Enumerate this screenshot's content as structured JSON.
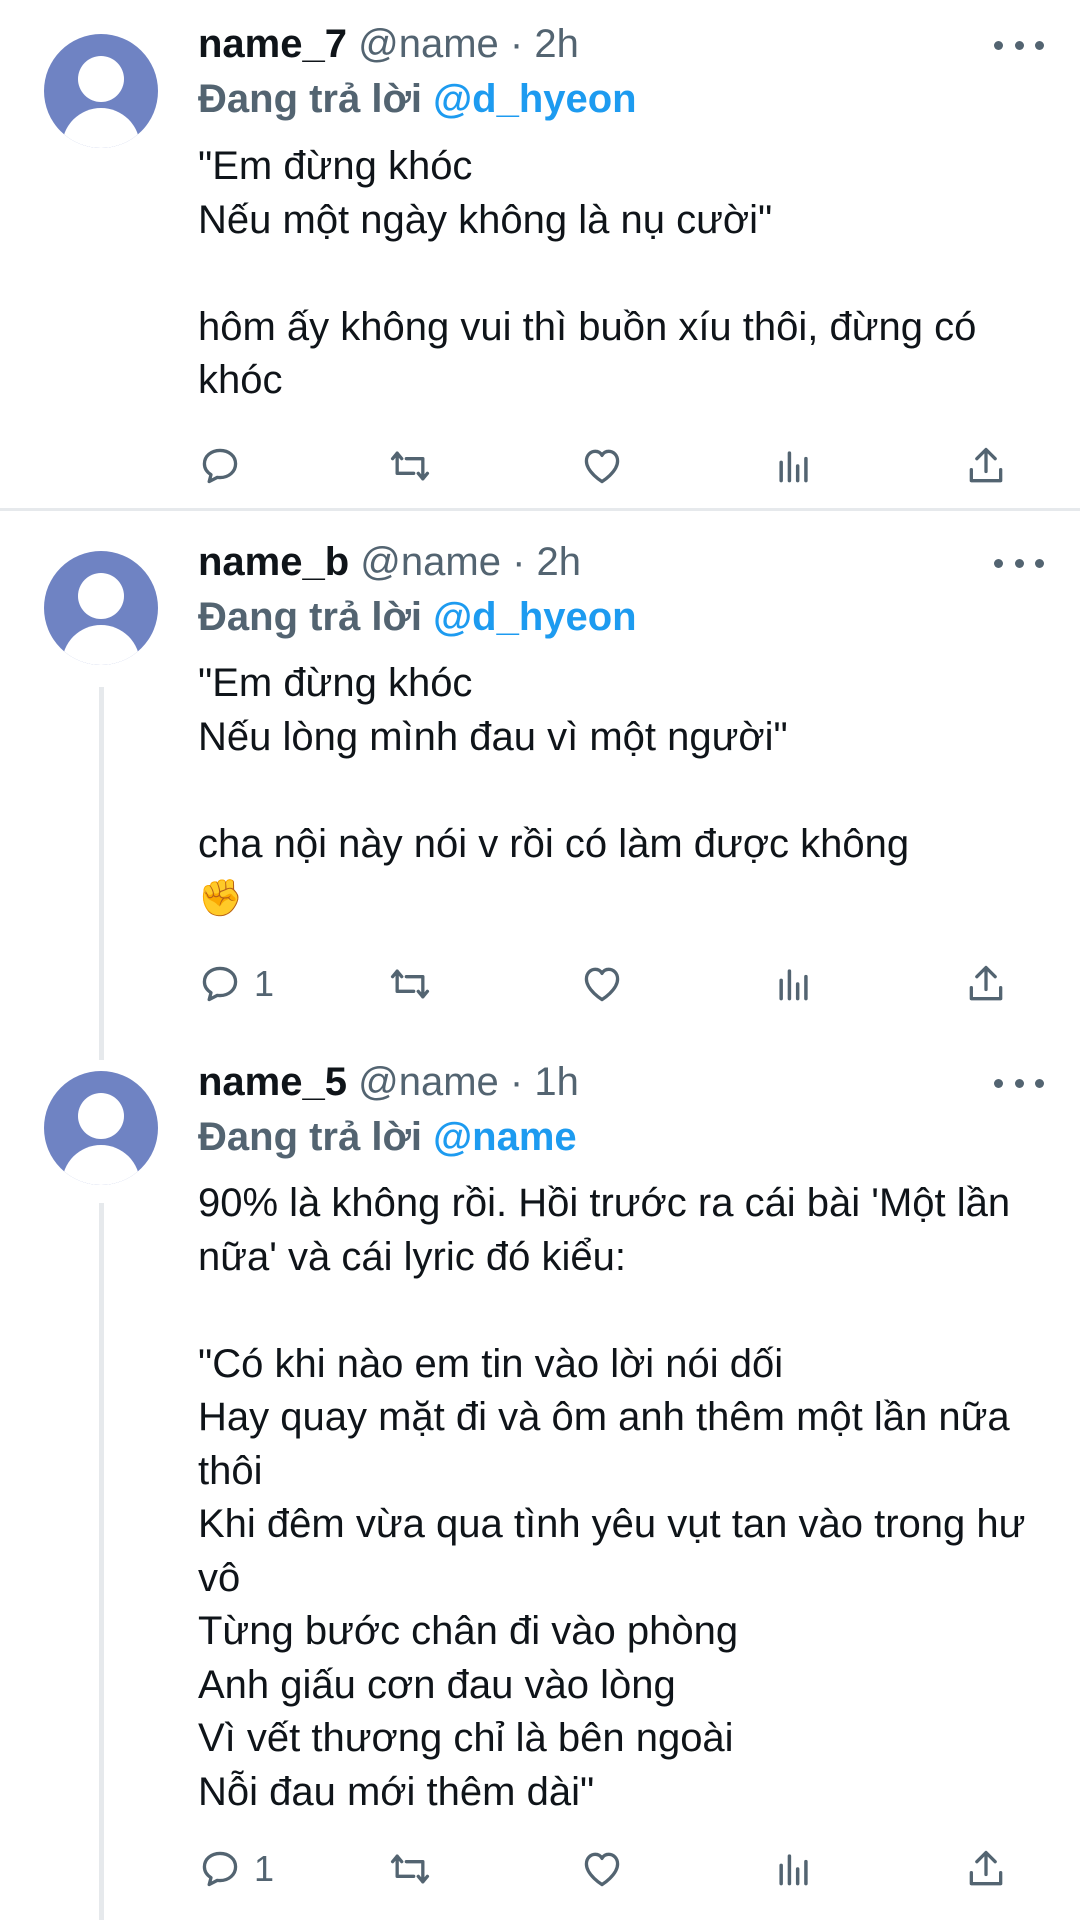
{
  "tweets": [
    {
      "name": "name_7",
      "handle": "@name",
      "dot": "·",
      "time": "2h",
      "reply_prefix": "Đang trả lời ",
      "reply_mention": "@d_hyeon",
      "text": "\"Em đừng khóc\nNếu một ngày không là nụ cười\"\n\nhôm ấy không vui thì buồn xíu thôi, đừng có khóc",
      "reply_count": ""
    },
    {
      "name": "name_b",
      "handle": "@name",
      "dot": "·",
      "time": "2h",
      "reply_prefix": "Đang trả lời ",
      "reply_mention": "@d_hyeon",
      "text": "\"Em đừng khóc\nNếu lòng mình đau vì một người\"\n\ncha nội này nói v rồi có làm được không",
      "emoji": "✊",
      "reply_count": "1"
    },
    {
      "name": "name_5",
      "handle": "@name",
      "dot": "·",
      "time": "1h",
      "reply_prefix": "Đang trả lời ",
      "reply_mention": "@name",
      "text": "90% là không rồi. Hồi trước ra cái bài 'Một lần nữa' và cái lyric đó kiểu:\n\n\"Có khi nào em tin vào lời nói dối\nHay quay mặt đi và ôm anh thêm một lần nữa thôi\nKhi đêm vừa qua tình yêu vụt tan vào trong hư vô\nTừng bước chân đi vào phòng\nAnh giấu cơn đau vào lòng\nVì vết thương chỉ là bên ngoài\nNỗi đau mới thêm dài\"",
      "reply_count": "1"
    }
  ],
  "icons": {
    "avatar": "default-profile-icon",
    "more": "more-icon",
    "reply": "reply-icon",
    "retweet": "retweet-icon",
    "like": "like-icon",
    "views": "views-icon",
    "share": "share-icon"
  },
  "colors": {
    "accent": "#1d9bf0",
    "muted": "#536471",
    "text": "#0f1419",
    "avatar": "#6f83c3",
    "separator": "#e6e9ec"
  }
}
